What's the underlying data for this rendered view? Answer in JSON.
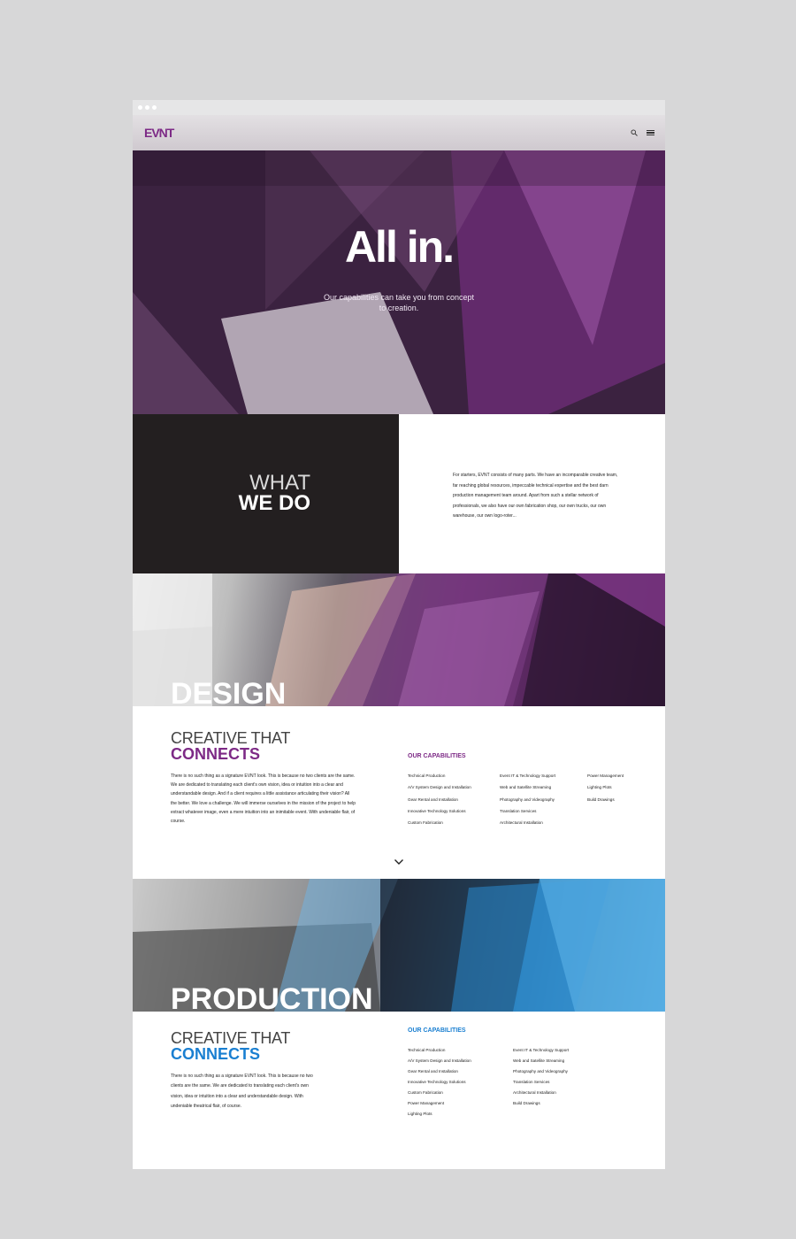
{
  "brand": {
    "logo": "EVNT",
    "accent": "#7d2a86",
    "accent_blue": "#1a7fd1"
  },
  "hero": {
    "title": "All in.",
    "subtitle": "Our capabilities can take you from concept to creation."
  },
  "what_we_do": {
    "heading_light": "WHAT",
    "heading_bold": "WE DO",
    "body": "For starters, EVNT consists of many parts. We have an incomparable creative team, far reaching global resources, impeccable technical expertise and the best darn production management team around. Apart from such a stellar network of professionals, we also have our own fabrication shop, our own trucks, our own warehouse, our own logo-roter..."
  },
  "design": {
    "banner": "DESIGN",
    "heading_light": "CREATIVE THAT",
    "heading_bold": "CONNECTS",
    "body": "There is no such thing as a signature EVNT look. This is because no two clients are the same. We are dedicated to translating each client's own vision, idea or intuition into a clear and understandable design. And if a client requires a little assistance articulating their vision? All the better. We love a challenge. We will immerse ourselves in the mission of the project to help extract whatever image, even a mere intuition into an inimitable event. With undeniable flair, of course.",
    "capabilities_title": "OUR CAPABILITIES",
    "columns": [
      [
        "Technical Production",
        "A/V System Design and Installation",
        "Gear Rental and Installation",
        "Innovative Technology Solutions",
        "Custom Fabrication"
      ],
      [
        "Event IT & Technology Support",
        "Web and Satellite Streaming",
        "Photography and Videography",
        "Translation Services",
        "Architectural Installation"
      ],
      [
        "Power Management",
        "Lighting Plots",
        "Build Drawings"
      ]
    ]
  },
  "production": {
    "banner": "PRODUCTION",
    "heading_light": "CREATIVE THAT",
    "heading_bold": "CONNECTS",
    "body": "There is no such thing as a signature EVNT look. This is because no two clients are the same. We are dedicated to translating each client's own vision, idea or intuition into a clear and understandable design. With undeniable theatrical flair, of course.",
    "capabilities_title": "OUR CAPABILITIES",
    "columns": [
      [
        "Technical Production",
        "A/V System Design and Installation",
        "Gear Rental and Installation",
        "Innovative Technology Solutions",
        "Custom Fabrication",
        "Power Management",
        "Lighting Plots"
      ],
      [
        "Event IT & Technology Support",
        "Web and Satellite Streaming",
        "Photography and Videography",
        "Translation Services",
        "Architectural Installation",
        "Build Drawings"
      ]
    ]
  },
  "icons": [
    "search-icon",
    "menu-icon",
    "chevron-down-icon"
  ]
}
